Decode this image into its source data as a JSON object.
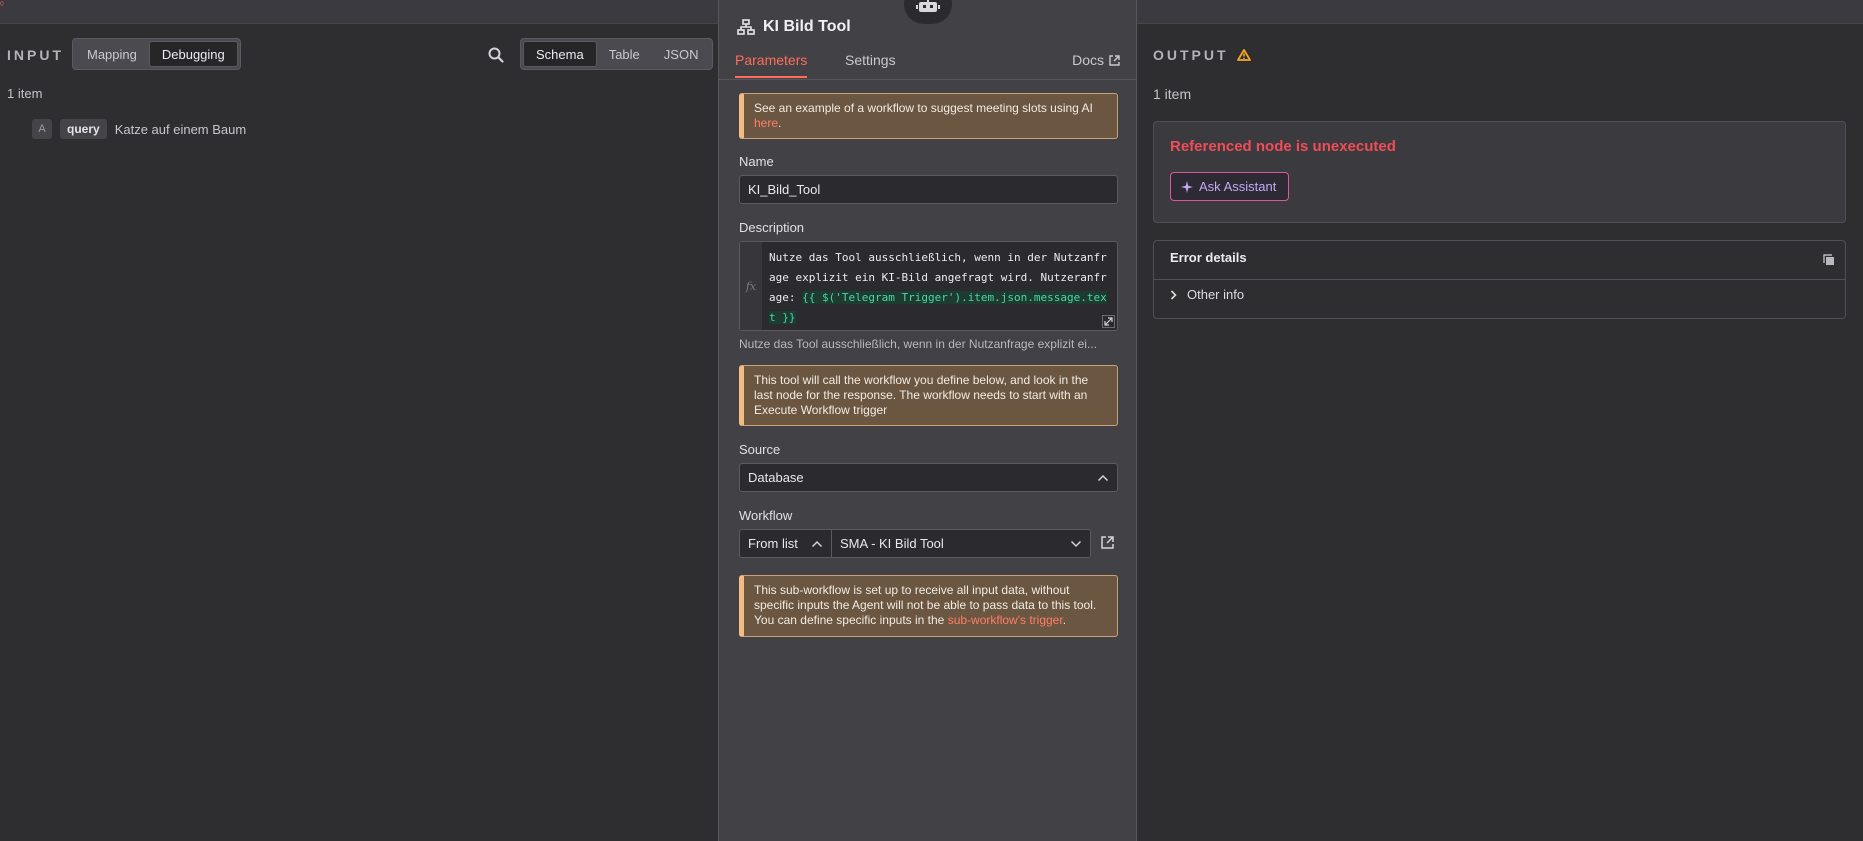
{
  "topbar": {
    "corner_glyph": "ᵒ"
  },
  "input": {
    "title": "INPUT",
    "mode_options": [
      "Mapping",
      "Debugging"
    ],
    "active_mode": "Debugging",
    "view_options": [
      "Schema",
      "Table",
      "JSON"
    ],
    "active_view": "Schema",
    "item_count": "1 item",
    "fields": [
      {
        "type": "A",
        "key": "query",
        "value": "Katze auf einem Baum"
      }
    ]
  },
  "node": {
    "title": "KI Bild Tool",
    "tabs": {
      "parameters": "Parameters",
      "settings": "Settings",
      "docs": "Docs"
    },
    "notice1": {
      "text": "See an example of a workflow to suggest meeting slots using AI ",
      "link": "here",
      "suffix": "."
    },
    "name": {
      "label": "Name",
      "value": "KI_Bild_Tool"
    },
    "description": {
      "label": "Description",
      "fx": "fx",
      "code_text": "Nutze das Tool ausschließlich, wenn in der Nutzanfrage explizit ein KI-Bild angefragt wird. Nutzeranfrage: ",
      "code_expr": "{{ $('Telegram Trigger').item.json.message.text }}",
      "preview": "Nutze das Tool ausschließlich, wenn in der Nutzanfrage explizit ei..."
    },
    "notice2": "This tool will call the workflow you define below, and look in the last node for the response. The workflow needs to start with an Execute Workflow trigger",
    "source": {
      "label": "Source",
      "value": "Database"
    },
    "workflow": {
      "label": "Workflow",
      "mode": "From list",
      "value": "SMA - KI Bild Tool"
    },
    "notice3": {
      "text": "This sub-workflow is set up to receive all input data, without specific inputs the Agent will not be able to pass data to this tool. You can define specific inputs in the ",
      "link": "sub-workflow's trigger",
      "suffix": "."
    }
  },
  "output": {
    "title": "OUTPUT",
    "item_count": "1 item",
    "error_title": "Referenced node is unexecuted",
    "ask_button": "Ask Assistant",
    "details_title": "Error details",
    "other_info": "Other info"
  },
  "colors": {
    "accent": "#ff6d5a",
    "error": "#f04d57",
    "warning": "#f5a623",
    "assistant": "#c5a7f5"
  }
}
